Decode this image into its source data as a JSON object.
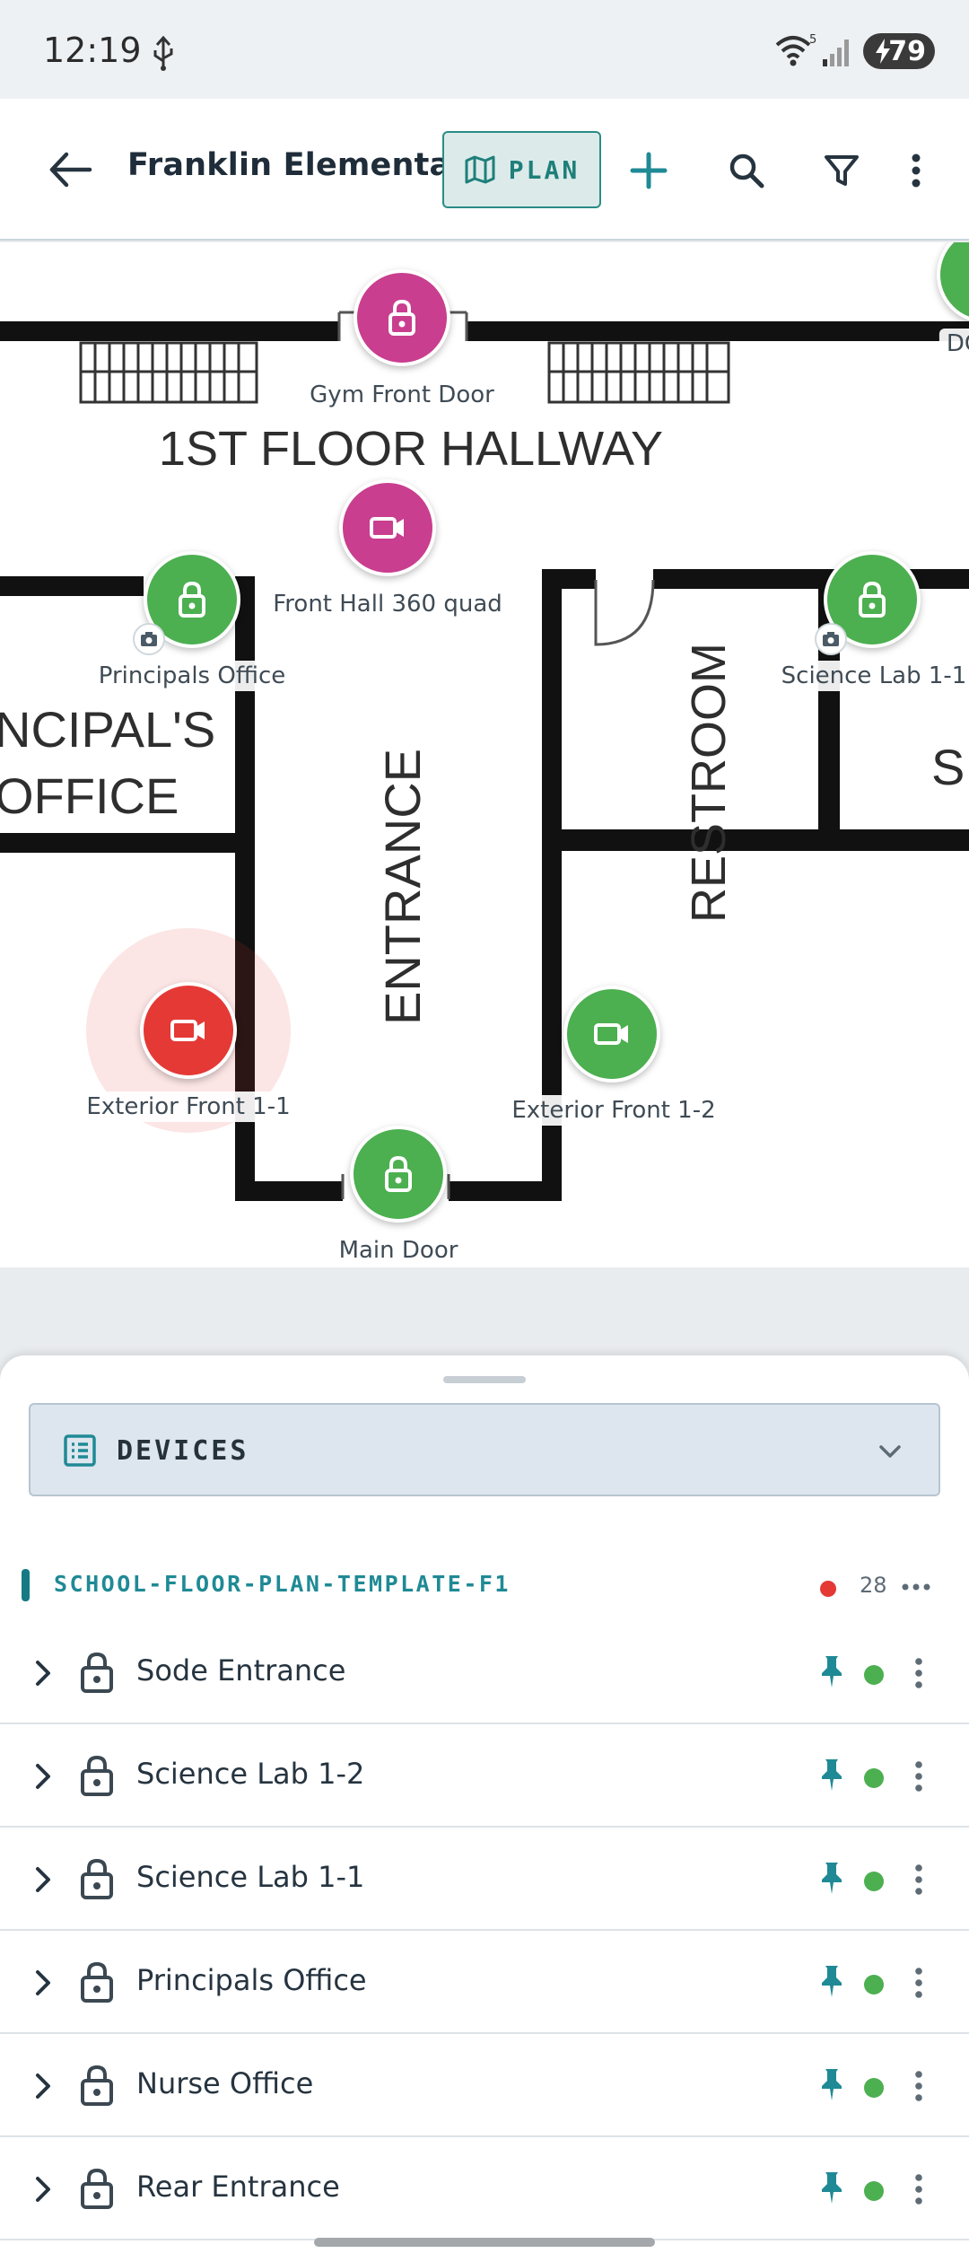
{
  "status_bar": {
    "time": "12:19",
    "battery": "79"
  },
  "app_bar": {
    "title": "Franklin Elementary",
    "plan_label": "PLAN"
  },
  "map": {
    "room_labels": {
      "hallway": "1ST FLOOR HALLWAY",
      "principal_line1": "NCIPAL'S",
      "principal_line2": "OFFICE",
      "entrance": "ENTRANCE",
      "restroom": "RESTROOM",
      "right_partial": "S"
    },
    "markers": [
      {
        "label": "Gym Front Door",
        "type": "lock",
        "color": "#c93e8f"
      },
      {
        "label": "Front Hall 360 quad",
        "type": "camera",
        "color": "#c93e8f"
      },
      {
        "label": "Principals Office",
        "type": "lock",
        "color": "#4caf50"
      },
      {
        "label": "Science Lab 1-1",
        "type": "lock",
        "color": "#4caf50"
      },
      {
        "label": "Exterior Front 1-1",
        "type": "camera",
        "color": "#e53935"
      },
      {
        "label": "Exterior Front 1-2",
        "type": "camera",
        "color": "#4caf50"
      },
      {
        "label": "Main Door",
        "type": "lock",
        "color": "#4caf50"
      },
      {
        "label": "DC",
        "type": "lock",
        "color": "#4caf50"
      }
    ]
  },
  "sheet": {
    "selector_label": "DEVICES",
    "group": {
      "name": "SCHOOL-FLOOR-PLAN-TEMPLATE-F1",
      "count": "28",
      "alert_color": "#e53935"
    },
    "devices": [
      {
        "name": "Sode Entrance",
        "status_color": "#4caf50"
      },
      {
        "name": "Science Lab 1-2",
        "status_color": "#4caf50"
      },
      {
        "name": "Science Lab 1-1",
        "status_color": "#4caf50"
      },
      {
        "name": "Principals Office",
        "status_color": "#4caf50"
      },
      {
        "name": "Nurse Office",
        "status_color": "#4caf50"
      },
      {
        "name": "Rear Entrance",
        "status_color": "#4caf50"
      }
    ]
  },
  "colors": {
    "accent": "#1f8a95",
    "online": "#4caf50",
    "alert": "#e53935",
    "lock_marker": "#c93e8f"
  }
}
